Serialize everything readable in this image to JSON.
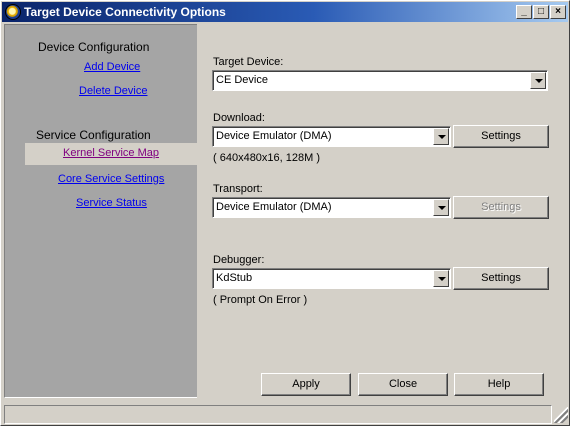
{
  "window": {
    "title": "Target Device Connectivity Options",
    "controls": {
      "minimize": "_",
      "maximize": "□",
      "close": "×"
    }
  },
  "sidebar": {
    "device_heading": "Device Configuration",
    "add_device": "Add Device",
    "delete_device": "Delete Device",
    "service_heading": "Service Configuration",
    "kernel_service_map": "Kernel Service Map",
    "core_service_settings": "Core Service Settings",
    "service_status": "Service Status"
  },
  "main": {
    "target_device": {
      "label": "Target Device:",
      "value": "CE Device"
    },
    "download": {
      "label": "Download:",
      "value": "Device Emulator (DMA)",
      "settings": "Settings",
      "note": "( 640x480x16, 128M )"
    },
    "transport": {
      "label": "Transport:",
      "value": "Device Emulator (DMA)",
      "settings": "Settings"
    },
    "debugger": {
      "label": "Debugger:",
      "value": "KdStub",
      "settings": "Settings",
      "note": "( Prompt On Error )"
    }
  },
  "footer": {
    "apply": "Apply",
    "close": "Close",
    "help": "Help"
  },
  "icons": {
    "app": "target-device-icon",
    "dropdown": "chevron-down-icon",
    "grip": "resize-grip-icon"
  },
  "colors": {
    "title_gradient_start": "#0a246a",
    "title_gradient_end": "#a6caf0",
    "face": "#d4d0c8",
    "sidebar": "#a5a5a5",
    "link": "#0000ee",
    "visited_link": "#800080"
  }
}
